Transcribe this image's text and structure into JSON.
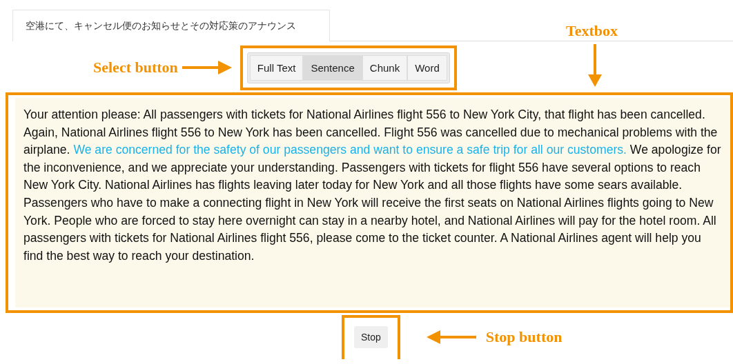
{
  "tab": {
    "label": "空港にて、キャンセル便のお知らせとその対応策のアナウンス",
    "selected": true
  },
  "select_control": {
    "annotation": "Select button",
    "options": [
      {
        "label": "Full Text",
        "selected": false
      },
      {
        "label": "Sentence",
        "selected": true
      },
      {
        "label": "Chunk",
        "selected": false
      },
      {
        "label": "Word",
        "selected": false
      }
    ]
  },
  "textbox": {
    "annotation": "Textbox",
    "segments": [
      {
        "text": "Your attention please: All passengers with tickets for National Airlines flight 556 to New York City, that flight has been cancelled. Again, National Airlines flight 556 to New York has been cancelled. Flight 556 was cancelled due to mechanical problems with the airplane. ",
        "highlighted": false
      },
      {
        "text": "We are concerned for the safety of our passengers and want to ensure a safe trip for all our customers.",
        "highlighted": true
      },
      {
        "text": " We apologize for the inconvenience, and we appreciate your understanding. Passengers with tickets for flight 556 have several options to reach New York City. National Airlines has flights leaving later today for New York and all those flights have some sears available. Passengers who have to make a connecting flight in New York will receive the first seats on National Airlines flights going to New York. People who are forced to stay here overnight can stay in a nearby hotel, and National Airlines will pay for the hotel room. All passengers with tickets for National Airlines flight 556, please come to the ticket counter. A National Airlines agent will help you find the best way to reach your destination.",
        "highlighted": false
      }
    ]
  },
  "stop": {
    "label": "Stop",
    "annotation": "Stop button"
  }
}
